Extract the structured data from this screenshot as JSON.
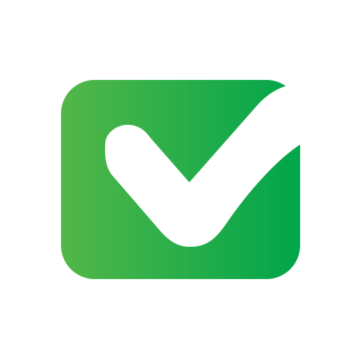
{
  "icon": {
    "name": "checkbox-checked-icon",
    "gradient_start": "#53B748",
    "gradient_end": "#00A54B",
    "check_color": "#FFFFFF",
    "background": "#FFFFFF"
  }
}
